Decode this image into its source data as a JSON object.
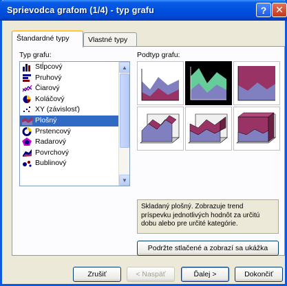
{
  "window": {
    "title": "Sprievodca grafom (1/4) - typ grafu",
    "help_glyph": "?",
    "close_glyph": "✕"
  },
  "tabs": [
    {
      "label": "Štandardné typy",
      "active": true
    },
    {
      "label": "Vlastné typy",
      "active": false
    }
  ],
  "chart_type": {
    "label": "Typ grafu:",
    "items": [
      {
        "label": "Stĺpcový",
        "icon": "column-chart-icon"
      },
      {
        "label": "Pruhový",
        "icon": "bar-chart-icon"
      },
      {
        "label": "Čiarový",
        "icon": "line-chart-icon"
      },
      {
        "label": "Koláčový",
        "icon": "pie-chart-icon"
      },
      {
        "label": "XY (závislosť)",
        "icon": "scatter-chart-icon"
      },
      {
        "label": "Plošný",
        "icon": "area-chart-icon"
      },
      {
        "label": "Prstencový",
        "icon": "doughnut-chart-icon"
      },
      {
        "label": "Radarový",
        "icon": "radar-chart-icon"
      },
      {
        "label": "Povrchový",
        "icon": "surface-chart-icon"
      },
      {
        "label": "Bublinový",
        "icon": "bubble-chart-icon"
      }
    ],
    "selected_index": 5
  },
  "subtype": {
    "label": "Podtyp grafu:",
    "selected_index": 1,
    "description": "Skladaný plošný. Zobrazuje trend príspevku jednotlivých hodnôt za určitú dobu alebo pre určité kategórie."
  },
  "buttons": {
    "press_to_view": "Podržte stlačené a zobrazí sa ukážka",
    "cancel": "Zrušiť",
    "back": "< Naspäť",
    "next": "Ďalej >",
    "finish": "Dokončiť"
  },
  "colors": {
    "title_bar": "#0050e0",
    "selection": "#316ac5",
    "series_purple": "#8080c0",
    "series_maroon": "#993366",
    "series_green": "#66cc99"
  }
}
